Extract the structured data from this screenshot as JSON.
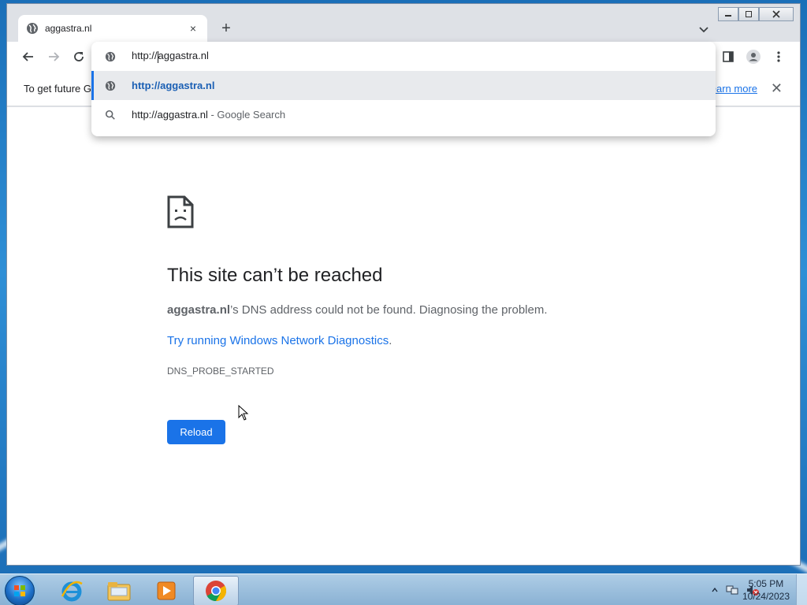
{
  "browser": {
    "tab_title": "aggastra.nl",
    "new_tab_label": "+",
    "tab_close": "×"
  },
  "omnibox": {
    "input_prefix": "http://",
    "input_suffix": "aggastra.nl",
    "suggestion_url": "http://aggastra.nl",
    "search_query": "http://aggastra.nl",
    "search_suffix": " - Google Search"
  },
  "infobar": {
    "text": "To get future G",
    "link": "earn more",
    "close": "✕"
  },
  "error_page": {
    "title": "This site can’t be reached",
    "host": "aggastra.nl",
    "description_rest": "’s DNS address could not be found. Diagnosing the problem.",
    "diagnostics_link": "Try running Windows Network Diagnostics",
    "diagnostics_period": ".",
    "error_code": "DNS_PROBE_STARTED",
    "reload_label": "Reload"
  },
  "taskbar": {
    "time": "5:05 PM",
    "date": "10/24/2023"
  },
  "colors": {
    "accent": "#1a73e8",
    "text_primary": "#202124",
    "text_secondary": "#5f6368"
  }
}
